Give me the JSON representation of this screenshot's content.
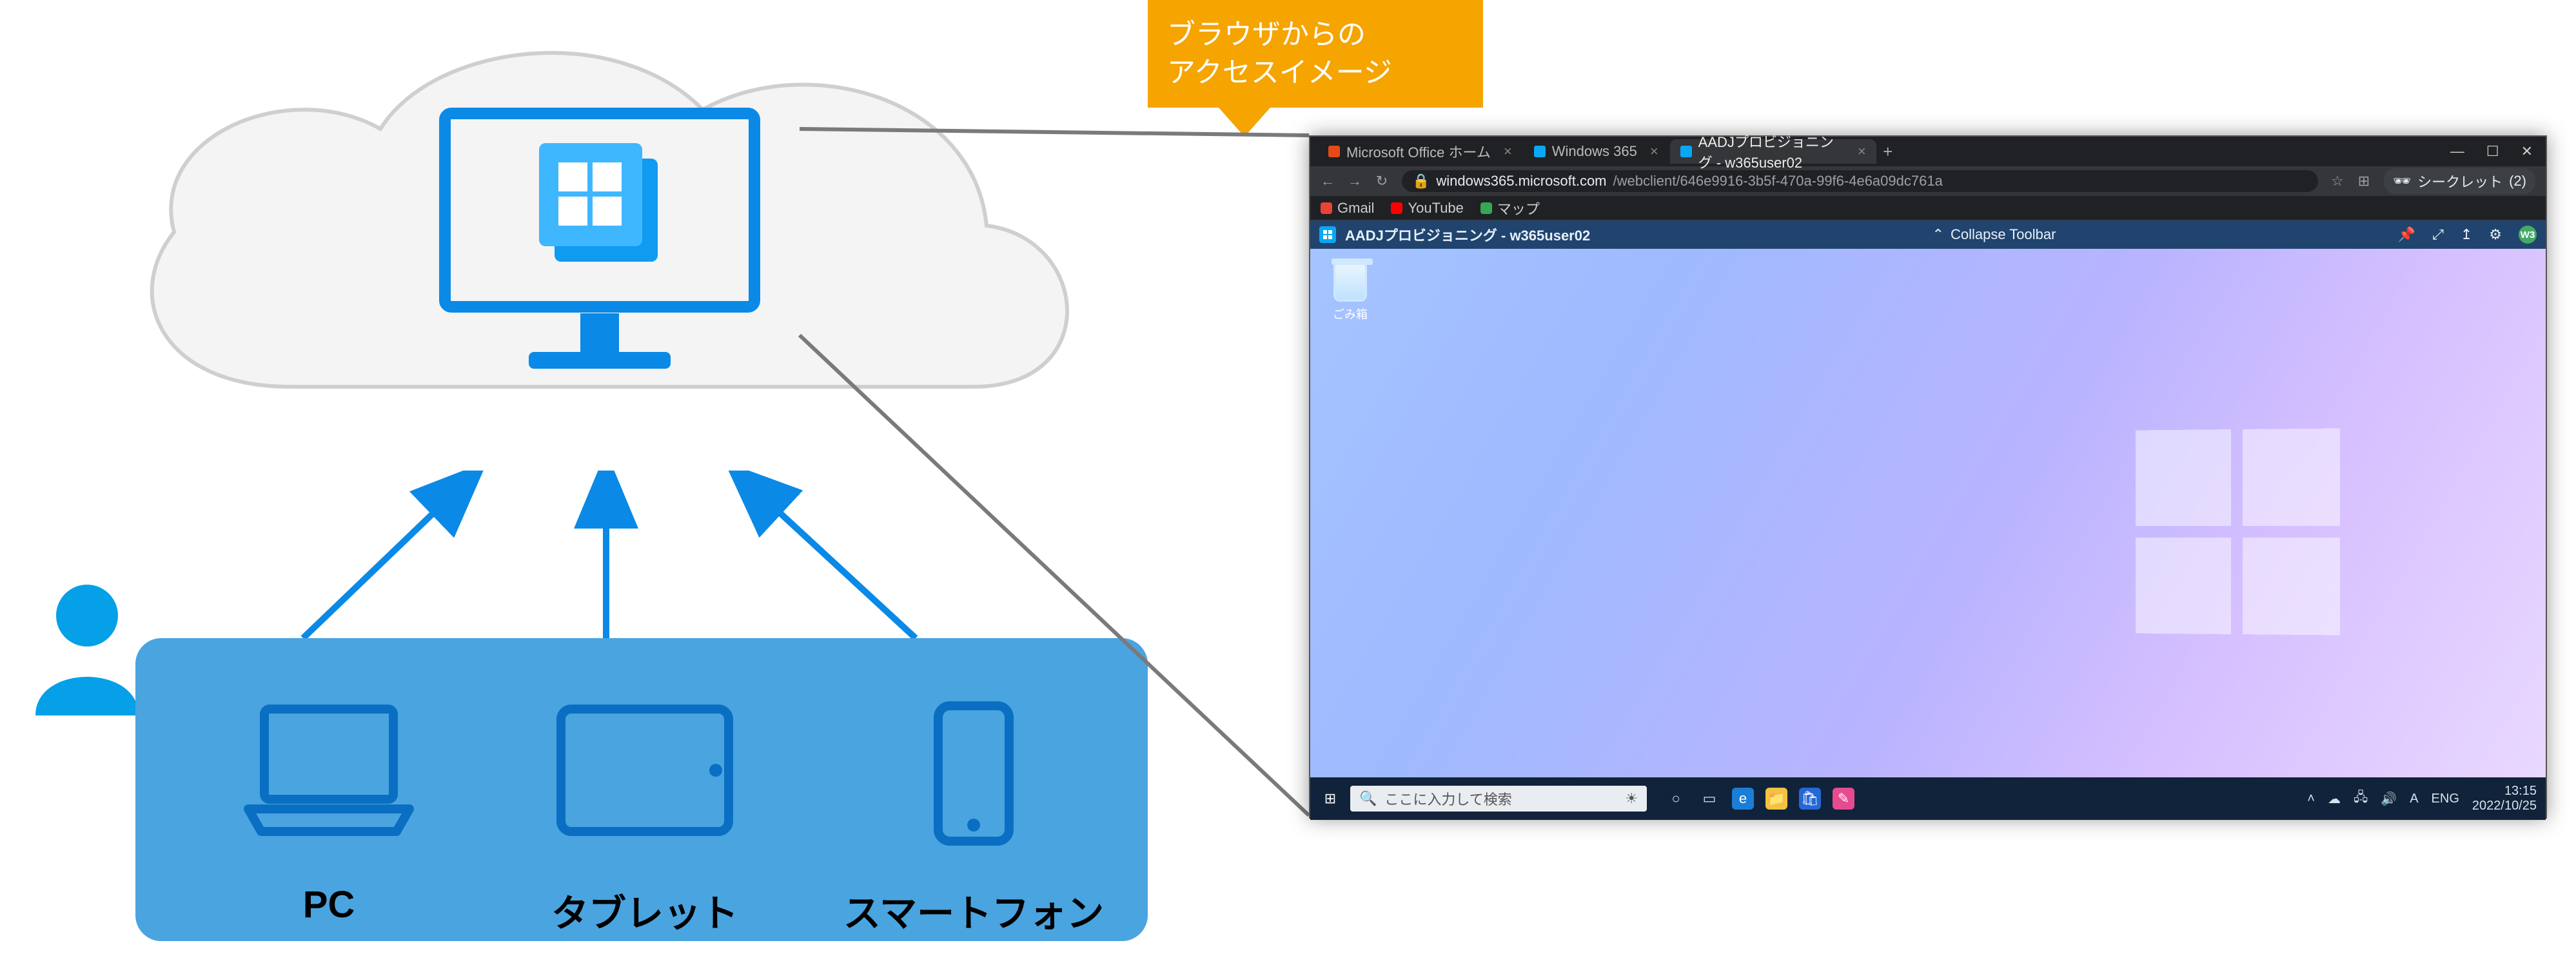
{
  "diagram": {
    "callout_line1": "ブラウザからの",
    "callout_line2": "アクセスイメージ",
    "devices": {
      "pc": "PC",
      "tablet": "タブレット",
      "smartphone": "スマートフォン"
    }
  },
  "browser": {
    "tabs": [
      {
        "label": "Microsoft Office ホーム",
        "favicon": "#e64a19",
        "active": false
      },
      {
        "label": "Windows 365",
        "favicon": "#09a8f4",
        "active": false
      },
      {
        "label": "AADJプロビジョニング - w365user02",
        "favicon": "#09a8f4",
        "active": true
      }
    ],
    "newtab_glyph": "+",
    "window_controls": {
      "min": "—",
      "max": "☐",
      "close": "✕"
    },
    "nav": {
      "back": "←",
      "forward": "→",
      "reload": "↻"
    },
    "address": {
      "lock": "🔒",
      "host": "windows365.microsoft.com",
      "path": "/webclient/646e9916-3b5f-470a-99f6-4e6a09dc761a"
    },
    "right_icons": {
      "star": "☆",
      "extension": "⊞"
    },
    "incognito": {
      "icon": "🕶",
      "label": "シークレット",
      "count": "(2)"
    },
    "bookmarks": [
      {
        "label": "Gmail",
        "color": "#ea4335"
      },
      {
        "label": "YouTube",
        "color": "#ff0000"
      },
      {
        "label": "マップ",
        "color": "#34a853"
      }
    ],
    "app_toolbar": {
      "title": "AADJプロビジョニング - w365user02",
      "collapse": "Collapse Toolbar",
      "collapse_glyph": "⌃",
      "icons": {
        "pin": "📌",
        "fullscreen": "⤢",
        "up": "↥",
        "settings": "⚙"
      },
      "avatar": "W3"
    },
    "cloud_desktop": {
      "recycle_bin": "ごみ箱"
    },
    "taskbar": {
      "start": "⊞",
      "search_icon": "🔍",
      "search_placeholder": "ここに入力して検索",
      "news_icon": "☀",
      "icons": {
        "taskview": "▭",
        "cortana": "○",
        "edge": "e",
        "explorer": "📁",
        "store": "🛍",
        "whiteboard": "✎"
      },
      "tray": {
        "chevron": "˄",
        "onedrive": "☁",
        "net": "🖧",
        "vol": "🔊",
        "ime": "A",
        "lang": "ENG",
        "time": "13:15",
        "date": "2022/10/25"
      }
    }
  }
}
